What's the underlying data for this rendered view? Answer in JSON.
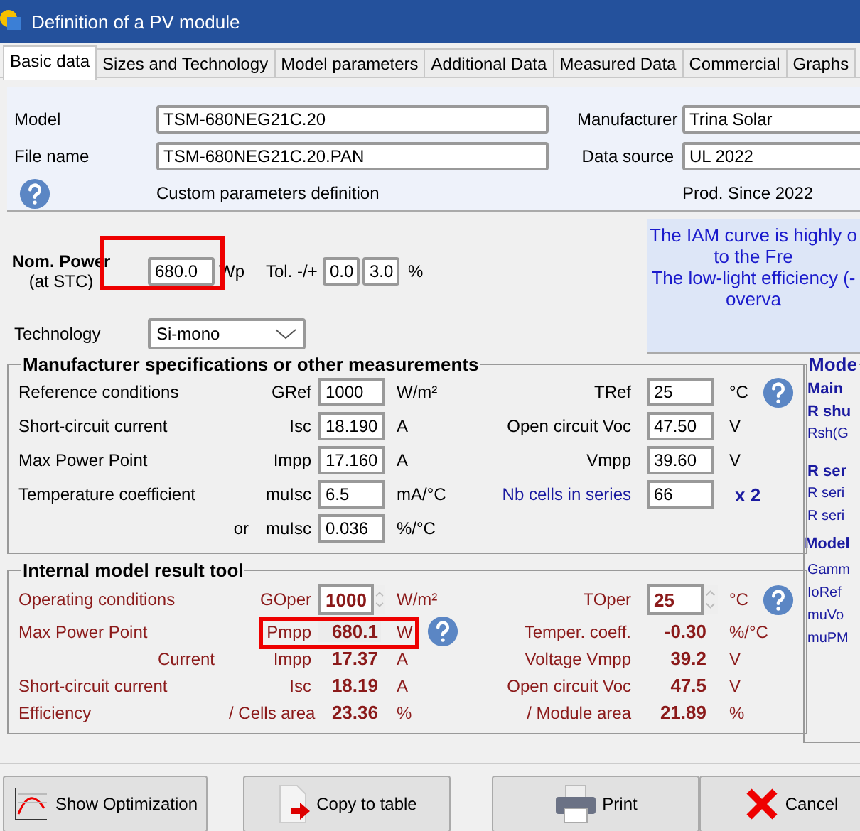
{
  "window": {
    "title": "Definition of a PV module"
  },
  "tabs": [
    {
      "label": "Basic data",
      "selected": true
    },
    {
      "label": "Sizes and Technology",
      "selected": false
    },
    {
      "label": "Model parameters",
      "selected": false
    },
    {
      "label": "Additional Data",
      "selected": false
    },
    {
      "label": "Measured Data",
      "selected": false
    },
    {
      "label": "Commercial",
      "selected": false
    },
    {
      "label": "Graphs",
      "selected": false
    }
  ],
  "identity": {
    "model_label": "Model",
    "model": "TSM-680NEG21C.20",
    "manufacturer_label": "Manufacturer",
    "manufacturer": "Trina Solar",
    "file_label": "File name",
    "file": "TSM-680NEG21C.20.PAN",
    "source_label": "Data source",
    "source": "UL 2022",
    "note": "Custom parameters definition",
    "production": "Prod. Since 2022"
  },
  "nominal": {
    "label": "Nom. Power",
    "sublabel": "(at STC)",
    "value": "680.0",
    "unit": "Wp",
    "highlighted": true,
    "tol_label": "Tol. -/+",
    "tol_minus": "0.0",
    "tol_plus": "3.0",
    "tol_unit": "%",
    "technology_label": "Technology",
    "technology": "Si-mono"
  },
  "info_lines": [
    "The IAM curve is highly o",
    "to the Fre",
    "The low-light efficiency (-",
    "overva"
  ],
  "specs": {
    "title": "Manufacturer specifications or other measurements",
    "rows": [
      {
        "label": "Reference conditions",
        "symbol": "GRef",
        "value": "1000",
        "unit": "W/m²",
        "right_label": "TRef",
        "accent": false,
        "right_value": "25",
        "right_unit": "°C"
      },
      {
        "label": "Short-circuit current",
        "symbol": "Isc",
        "value": "18.190",
        "unit": "A",
        "right_label": "Open circuit Voc",
        "accent": false,
        "right_value": "47.50",
        "right_unit": "V"
      },
      {
        "label": "Max Power Point",
        "symbol": "Impp",
        "value": "17.160",
        "unit": "A",
        "right_label": "Vmpp",
        "accent": false,
        "right_value": "39.60",
        "right_unit": "V"
      },
      {
        "label": "Temperature coefficient",
        "symbol": "muIsc",
        "value": "6.5",
        "unit": "mA/°C",
        "right_label": "Nb cells in series",
        "accent": true,
        "right_value": "66",
        "right_unit": "x 2"
      },
      {
        "qualifier": "or",
        "symbol": "muIsc",
        "value": "0.036",
        "unit": "%/°C"
      }
    ]
  },
  "result": {
    "title": "Internal model result tool",
    "rows": [
      {
        "kind": "input",
        "label": "Operating conditions",
        "symbol": "GOper",
        "value": "1000",
        "unit": "W/m²",
        "right_label": "TOper",
        "right_value": "25",
        "right_unit": "°C"
      },
      {
        "kind": "output",
        "label": "Max Power Point",
        "symbol": "Pmpp",
        "value": "680.1",
        "unit": "W",
        "highlighted": true,
        "right_label": "Temper. coeff.",
        "right_value": "-0.30",
        "right_unit": "%/°C"
      },
      {
        "kind": "output",
        "sublabel": "Current",
        "symbol": "Impp",
        "value": "17.37",
        "unit": "A",
        "right_label": "Voltage Vmpp",
        "right_value": "39.2",
        "right_unit": "V"
      },
      {
        "kind": "output",
        "label": "Short-circuit current",
        "symbol": "Isc",
        "value": "18.19",
        "unit": "A",
        "right_label": "Open circuit Voc",
        "right_value": "47.5",
        "right_unit": "V"
      },
      {
        "kind": "output",
        "label": "Efficiency",
        "symbol": "/ Cells area",
        "value": "23.36",
        "unit": "%",
        "right_label": "/ Module area",
        "right_value": "21.89",
        "right_unit": "%"
      }
    ]
  },
  "side_panel": {
    "title": "Mode",
    "items": [
      {
        "kind": "heading",
        "text": "Main"
      },
      {
        "kind": "heading",
        "text": "R shu"
      },
      {
        "kind": "text",
        "text": "Rsh(G"
      },
      {
        "kind": "gap"
      },
      {
        "kind": "heading",
        "text": "R ser"
      },
      {
        "kind": "text",
        "text": "R seri"
      },
      {
        "kind": "text",
        "text": "R seri"
      },
      {
        "kind": "section",
        "text": "Model"
      },
      {
        "kind": "text",
        "text": "Gamm"
      },
      {
        "kind": "text",
        "text": "IoRef"
      },
      {
        "kind": "text",
        "text": "muVo"
      },
      {
        "kind": "text",
        "text": "muPM"
      }
    ]
  },
  "buttons": [
    {
      "kind": "chart",
      "label": "Show Optimization"
    },
    {
      "kind": "copy",
      "label": "Copy to table"
    },
    {
      "kind": "print",
      "label": "Print"
    },
    {
      "kind": "cancel",
      "label": "Cancel"
    }
  ]
}
